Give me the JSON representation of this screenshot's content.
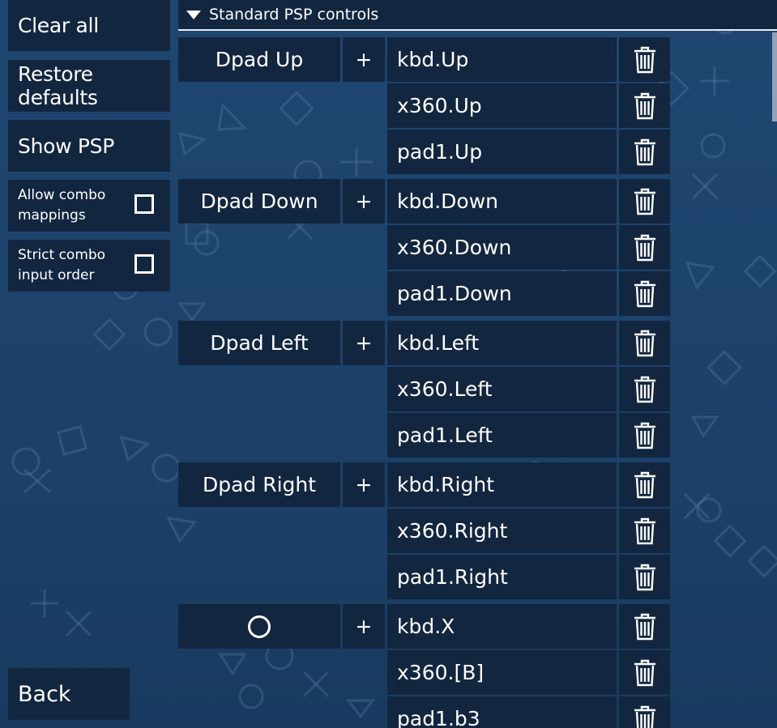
{
  "sidebar": {
    "clear_all": "Clear all",
    "restore_defaults": "Restore defaults",
    "show_psp": "Show PSP",
    "allow_combo": "Allow combo mappings",
    "strict_combo": "Strict combo input order",
    "back": "Back"
  },
  "section": {
    "title": "Standard PSP controls"
  },
  "plus_label": "+",
  "controls": [
    {
      "name": "Dpad Up",
      "mappings": [
        "kbd.Up",
        "x360.Up",
        "pad1.Up"
      ]
    },
    {
      "name": "Dpad Down",
      "mappings": [
        "kbd.Down",
        "x360.Down",
        "pad1.Down"
      ]
    },
    {
      "name": "Dpad Left",
      "mappings": [
        "kbd.Left",
        "x360.Left",
        "pad1.Left"
      ]
    },
    {
      "name": "Dpad Right",
      "mappings": [
        "kbd.Right",
        "x360.Right",
        "pad1.Right"
      ]
    },
    {
      "name": "",
      "icon": "circle-icon",
      "mappings": [
        "kbd.X",
        "x360.[B]",
        "pad1.b3"
      ]
    }
  ],
  "colors": {
    "panel": "#132640",
    "background": "#1d446d",
    "text": "#ffffff"
  }
}
